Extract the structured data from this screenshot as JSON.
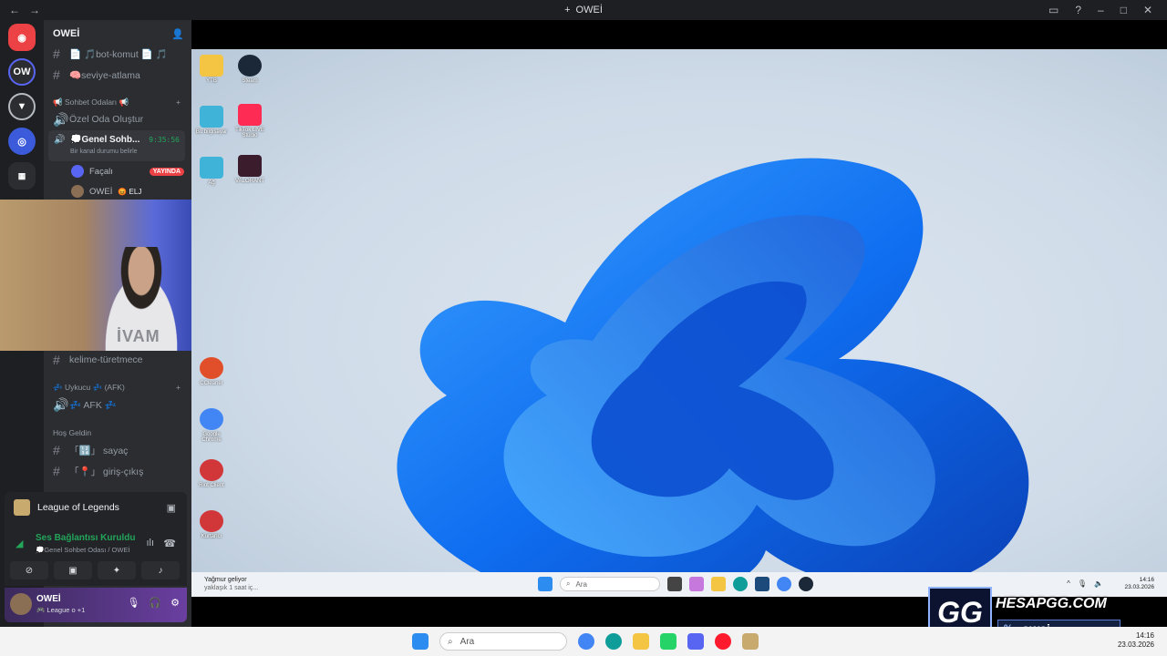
{
  "window": {
    "title": "OWEİ",
    "tab_icon": "plus-icon"
  },
  "server": {
    "name": "OWEİ"
  },
  "channels": {
    "text_top": [
      {
        "label": "📄 🎵bot-komut 📄 🎵"
      },
      {
        "label": "🧠seviye-atlama"
      }
    ],
    "voice_category": "📢 Sohbet Odaları 📢",
    "create_room": "Özel Oda Oluştur",
    "active_voice": {
      "name": "💭Genel Sohb...",
      "timer": "9:35:56",
      "status": "Bir kanal durumu belirle"
    },
    "voice_users": [
      {
        "name": "Façalı",
        "badge": "YAYINDA"
      },
      {
        "name": "OWEİ",
        "badge": "😡 ELJ"
      }
    ],
    "kelime": "kelime-türetmece",
    "afk_category": "💤 Uykucu 💤 (AFK)",
    "afk_channel": "💤 AFK 💤",
    "welcome_category": "Hoş Geldin",
    "welcome_channels": [
      "「🔢」 sayaç",
      "「📍」 giriş-çıkış"
    ]
  },
  "voice_panel": {
    "game": "League of Legends",
    "connection": "Ses Bağlantısı Kuruldu",
    "location": "💭Genel Sohbet Odası / OWEİ"
  },
  "user_panel": {
    "name": "OWEİ",
    "status": "🎮 League o +1"
  },
  "webcam": {
    "shirt_text": "İVAM"
  },
  "desktop_icons": [
    {
      "label": "YTB",
      "icon": "folder-icon",
      "color": "#f4c542"
    },
    {
      "label": "Steam",
      "icon": "steam-icon",
      "color": "#1b2838"
    },
    {
      "label": "Bu bilgisayar",
      "icon": "computer-icon",
      "color": "#3fb4d8"
    },
    {
      "label": "TikTok LIVE Studio",
      "icon": "tiktok-icon",
      "color": "#fe2c55"
    },
    {
      "label": "Ağ",
      "icon": "network-icon",
      "color": "#3fb4d8"
    },
    {
      "label": "VALORANT",
      "icon": "valorant-icon",
      "color": "#3a1c2c"
    },
    {
      "label": "CCleaner",
      "icon": "ccleaner-icon",
      "color": "#e04f2a"
    },
    {
      "label": "Google Chrome",
      "icon": "chrome-icon",
      "color": "#4285f4"
    },
    {
      "label": "Riot Client",
      "icon": "riot-icon",
      "color": "#d13639"
    },
    {
      "label": "Kurtarıcı",
      "icon": "riot-icon",
      "color": "#d13639"
    }
  ],
  "inner_taskbar": {
    "weather_title": "Yağmur geliyor",
    "weather_sub": "yaklaşık 1 saat iç...",
    "search": "Ara",
    "time": "14:16",
    "date": "23.03.2026"
  },
  "host_taskbar": {
    "search": "Ara",
    "time": "14:16",
    "date": "23.03.2026"
  },
  "brand": {
    "logo": "GG",
    "name": "HESAPGG.COM",
    "pct": "%",
    "user": "owei"
  },
  "colors": {
    "accent": "#5865f2",
    "online": "#23a55a",
    "live": "#ed4245"
  }
}
